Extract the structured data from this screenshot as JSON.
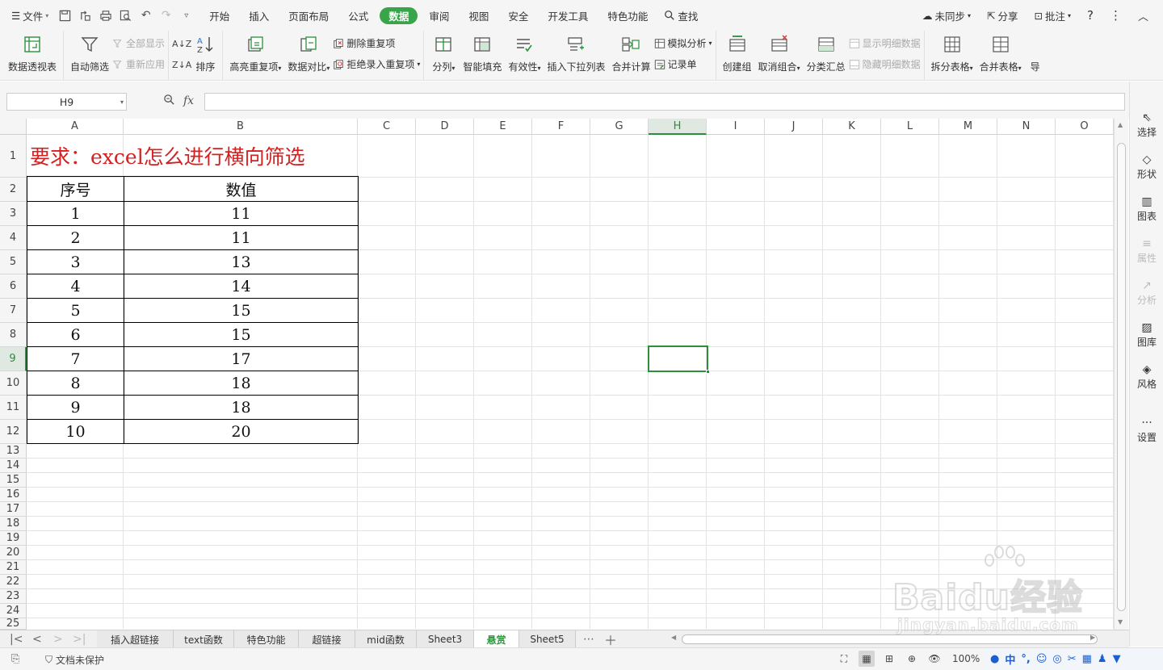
{
  "menubar": {
    "file": "文件",
    "tabs": [
      "开始",
      "插入",
      "页面布局",
      "公式",
      "数据",
      "审阅",
      "视图",
      "安全",
      "开发工具",
      "特色功能"
    ],
    "active_tab": "数据",
    "search": "查找",
    "sync": "未同步",
    "share": "分享",
    "comment": "批注"
  },
  "ribbon": {
    "pivot": "数据透视表",
    "autofilter": "自动筛选",
    "show_all": "全部显示",
    "reapply": "重新应用",
    "sort": "排序",
    "highlight_dup": "高亮重复项",
    "data_compare": "数据对比",
    "delete_dup": "删除重复项",
    "reject_dup": "拒绝录入重复项",
    "split_col": "分列",
    "smart_fill": "智能填充",
    "validity": "有效性",
    "dropdown_list": "插入下拉列表",
    "consolidate": "合并计算",
    "simulate": "模拟分析",
    "record_sheet": "记录单",
    "create_group": "创建组",
    "ungroup": "取消组合",
    "subtotal": "分类汇总",
    "show_detail": "显示明细数据",
    "hide_detail": "隐藏明细数据",
    "split_table": "拆分表格",
    "merge_table": "合并表格",
    "more": "导"
  },
  "formula_bar": {
    "name_box": "H9",
    "fx": "fx",
    "content": ""
  },
  "columns": [
    "A",
    "B",
    "C",
    "D",
    "E",
    "F",
    "G",
    "H",
    "I",
    "J",
    "K",
    "L",
    "M",
    "N",
    "O"
  ],
  "selected_col": "H",
  "rows": [
    "1",
    "2",
    "3",
    "4",
    "5",
    "6",
    "7",
    "8",
    "9",
    "10",
    "11",
    "12",
    "13",
    "14",
    "15",
    "16",
    "17",
    "18",
    "19",
    "20",
    "21",
    "22",
    "23",
    "24",
    "25"
  ],
  "selected_row": "9",
  "sheet": {
    "title": "要求：excel怎么进行横向筛选",
    "headers": [
      "序号",
      "数值"
    ],
    "data": [
      [
        "1",
        "11"
      ],
      [
        "2",
        "11"
      ],
      [
        "3",
        "13"
      ],
      [
        "4",
        "14"
      ],
      [
        "5",
        "15"
      ],
      [
        "6",
        "15"
      ],
      [
        "7",
        "17"
      ],
      [
        "8",
        "18"
      ],
      [
        "9",
        "18"
      ],
      [
        "10",
        "20"
      ]
    ]
  },
  "right_pane": [
    "选择",
    "形状",
    "图表",
    "属性",
    "分析",
    "图库",
    "风格",
    "设置"
  ],
  "sheet_tabs": [
    "插入超链接",
    "text函数",
    "特色功能",
    "超链接",
    "mid函数",
    "Sheet3",
    "悬赏",
    "Sheet5"
  ],
  "active_sheet": "悬赏",
  "status": {
    "protect": "文档未保护",
    "zoom": "100%"
  },
  "ime": {
    "lang": "中"
  },
  "watermark": {
    "brand": "Baidu经验",
    "url": "jingyan.baidu.com"
  },
  "colors": {
    "accent": "#38a54a",
    "title_red": "#d42020"
  }
}
